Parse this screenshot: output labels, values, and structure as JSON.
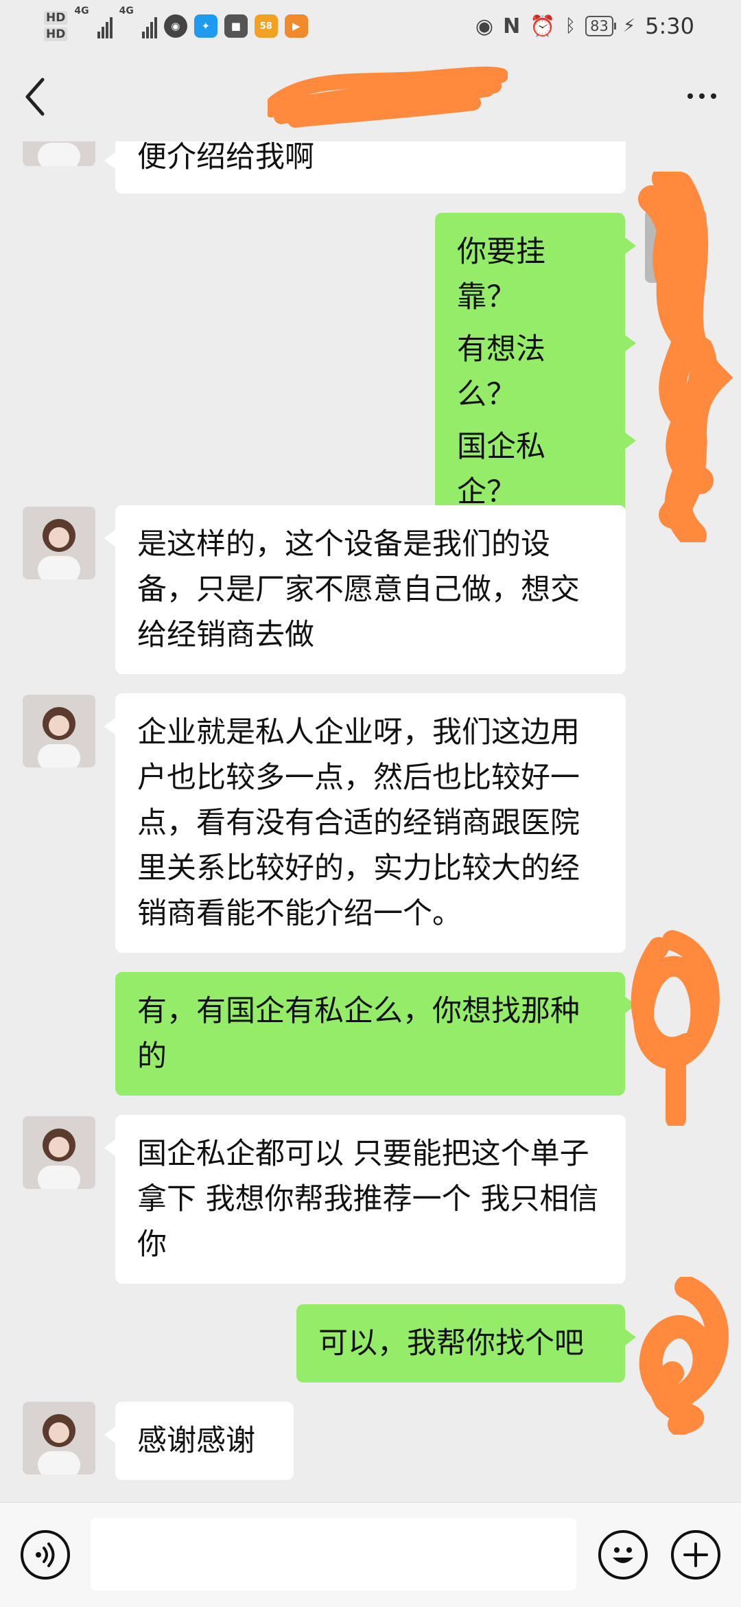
{
  "status_bar": {
    "hd1": "HD",
    "hd2": "HD",
    "net1": "4G",
    "net2": "4G",
    "battery": "83",
    "time": "5:30"
  },
  "header": {
    "title": "",
    "back_icon": "chevron-left-icon",
    "more_icon": "more-dots-icon"
  },
  "messages": [
    {
      "from": "them",
      "text": "便介绍给我啊",
      "show_avatar": false
    },
    {
      "from": "me",
      "text": "你要挂靠？"
    },
    {
      "from": "me",
      "text": "有想法么？"
    },
    {
      "from": "me",
      "text": "国企私企？"
    },
    {
      "from": "them",
      "text": "是这样的，这个设备是我们的设备，只是厂家不愿意自己做，想交给经销商去做",
      "show_avatar": true
    },
    {
      "from": "them",
      "text": "企业就是私人企业呀，我们这边用户也比较多一点，然后也比较好一点，看有没有合适的经销商跟医院里关系比较好的，实力比较大的经销商看能不能介绍一个。",
      "show_avatar": true
    },
    {
      "from": "me",
      "text": "有，有国企有私企么，你想找那种的"
    },
    {
      "from": "them",
      "text": "国企私企都可以 只要能把这个单子拿下 我想你帮我推荐一个 我只相信你",
      "show_avatar": true
    },
    {
      "from": "me",
      "text": "可以，我帮你找个吧"
    },
    {
      "from": "them",
      "text": "感谢感谢",
      "show_avatar": true
    }
  ],
  "input_bar": {
    "placeholder": "",
    "voice_icon": "voice-icon",
    "emoji_icon": "emoji-icon",
    "plus_icon": "plus-icon"
  },
  "colors": {
    "background": "#ededed",
    "my_bubble": "#95ec69",
    "their_bubble": "#ffffff",
    "redaction": "#ff8a3d"
  }
}
